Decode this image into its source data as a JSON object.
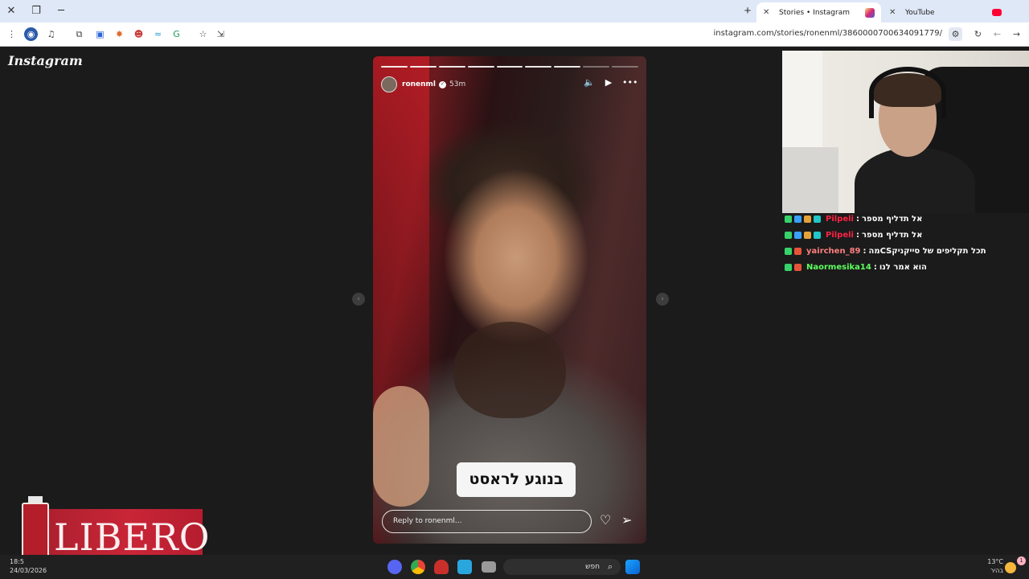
{
  "browser": {
    "tabs": [
      {
        "label": "Stories • Instagram",
        "active": true,
        "icon": "instagram-icon",
        "icon_color": "#e1306c"
      },
      {
        "label": "YouTube",
        "active": false,
        "icon": "youtube-icon",
        "icon_color": "#ff0033"
      }
    ],
    "url": "instagram.com/stories/ronenml/3860000700634091779/"
  },
  "instagram": {
    "logo": "Instagram",
    "story": {
      "username": "ronenml",
      "time_ago": "53m",
      "caption": "בנוגע לראסט",
      "reply_placeholder": "Reply to ronenml...",
      "segments_total": 9,
      "segments_done": 7
    }
  },
  "chat": {
    "messages": [
      {
        "user": "Pilpeli",
        "message": "אל תדליף מספר",
        "color": "#ff2244"
      },
      {
        "user": "Pilpeli",
        "message": "אל תדליף מספר",
        "color": "#ff2244"
      },
      {
        "user": "yairchen_89",
        "message": "מהCSתכל תקליפים של סייקניק",
        "color": "#ff7f7f"
      },
      {
        "user": "Naormesika14",
        "message": "הוא אמר לנו",
        "color": "#5dff5d"
      }
    ]
  },
  "promo": {
    "brand": "LIBERO"
  },
  "taskbar": {
    "time": "18:5",
    "date": "24/03/2026",
    "search_placeholder": "חפש",
    "temperature": "13°C",
    "weather_text": "בהיר",
    "notification_count": "1"
  }
}
